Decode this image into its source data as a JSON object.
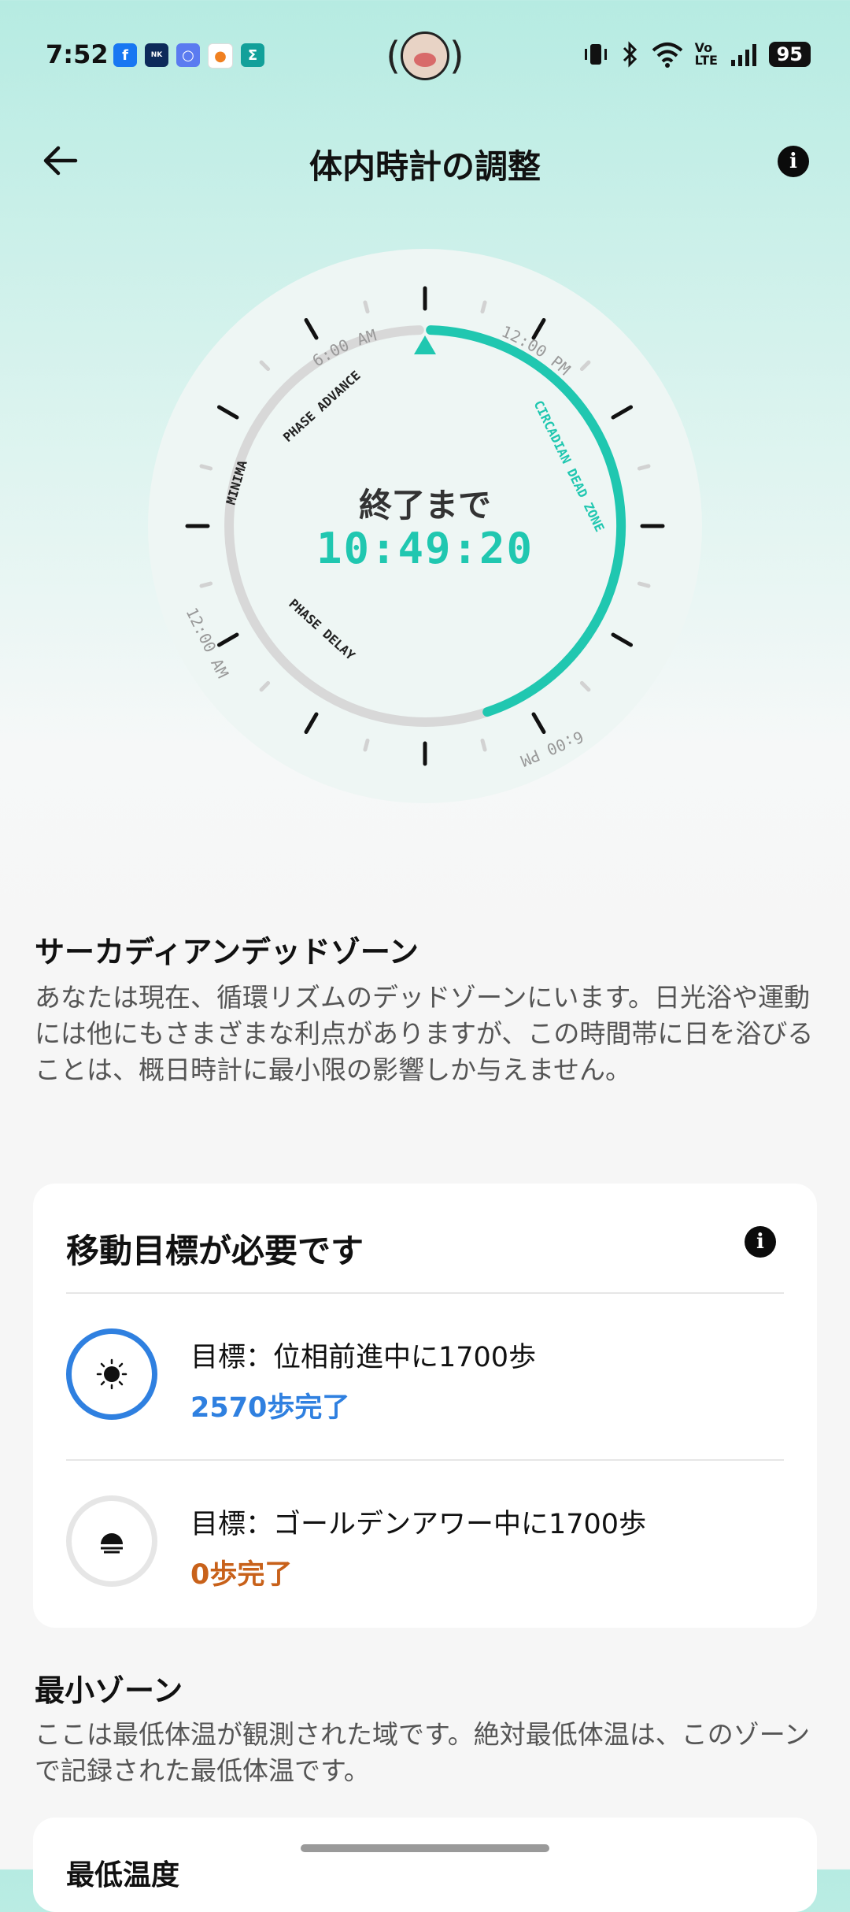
{
  "status_bar": {
    "time": "7:52",
    "battery": "95",
    "volte": "Vo LTE"
  },
  "header": {
    "title": "体内時計の調整",
    "back_icon": "arrow-left-icon",
    "info_icon": "info-icon"
  },
  "dial": {
    "labels": {
      "am6": "6:00 AM",
      "pm12": "12:00 PM",
      "pm6": "6:00 PM",
      "am12": "12:00 AM",
      "phase_advance": "PHASE ADVANCE",
      "minima": "MINIMA",
      "phase_delay": "PHASE DELAY",
      "dead_zone": "CIRCADIAN DEAD ZONE"
    },
    "until_label": "終了まで",
    "countdown": "10:49:20",
    "accent": "#20c7b0"
  },
  "dead_zone": {
    "title": "サーカディアンデッドゾーン",
    "body": "あなたは現在、循環リズムのデッドゾーンにいます。日光浴や運動には他にもさまざまな利点がありますが、この時間帯に日を浴びることは、概日時計に最小限の影響しか与えません。"
  },
  "movement_card": {
    "title": "移動目標が必要です",
    "goals": [
      {
        "icon": "sun-icon",
        "label": "目標：位相前進中に1700歩",
        "progress": "2570歩完了",
        "color": "#2f80e0"
      },
      {
        "icon": "sunset-icon",
        "label": "目標：ゴールデンアワー中に1700歩",
        "progress": "0歩完了",
        "color": "#c8611a"
      }
    ]
  },
  "min_zone": {
    "title": "最小ゾーン",
    "body": "ここは最低体温が観測された域です。絶対最低体温は、このゾーンで記録された最低体温です。",
    "card_title": "最低温度"
  }
}
